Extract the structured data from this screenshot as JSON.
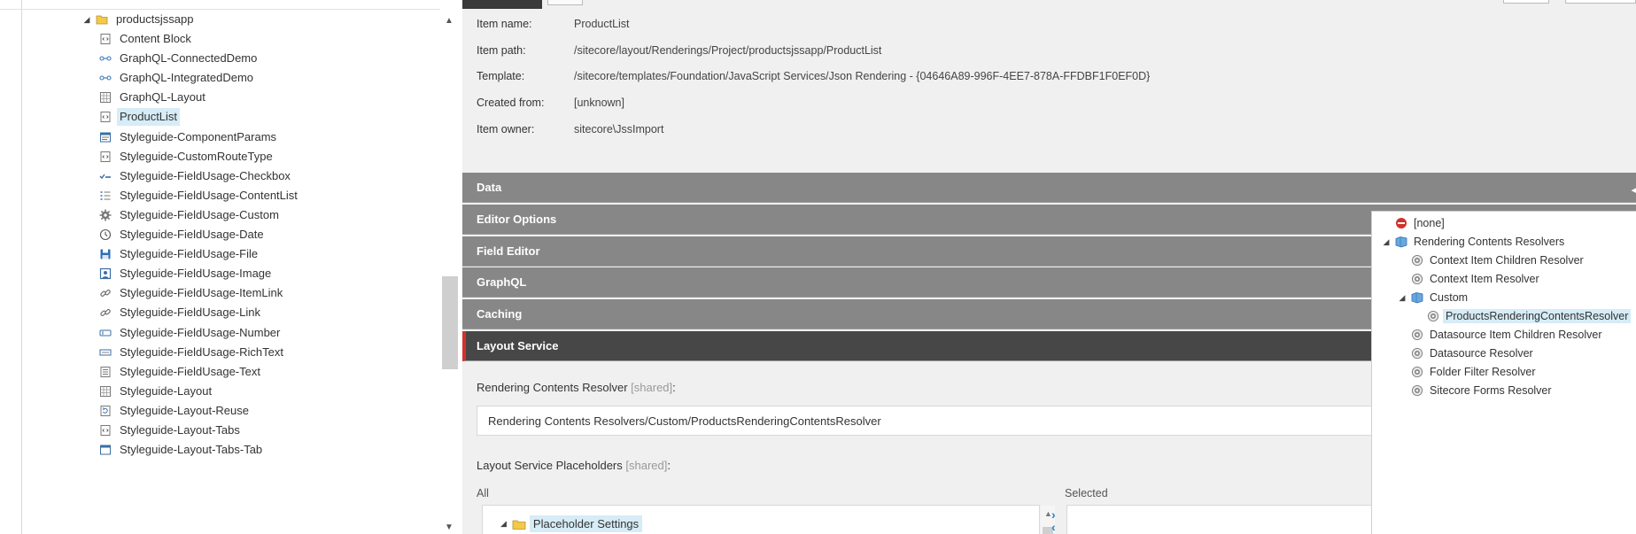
{
  "tree": {
    "parent": {
      "label": "productsjssapp",
      "icon": "folder-icon"
    },
    "items": [
      {
        "label": "Content Block",
        "icon": "json-rendering-icon"
      },
      {
        "label": "GraphQL-ConnectedDemo",
        "icon": "graphql-link-icon"
      },
      {
        "label": "GraphQL-IntegratedDemo",
        "icon": "graphql-link-icon"
      },
      {
        "label": "GraphQL-Layout",
        "icon": "grid-layout-icon"
      },
      {
        "label": "ProductList",
        "icon": "json-rendering-icon",
        "selected": true
      },
      {
        "label": "Styleguide-ComponentParams",
        "icon": "params-form-icon"
      },
      {
        "label": "Styleguide-CustomRouteType",
        "icon": "json-rendering-icon"
      },
      {
        "label": "Styleguide-FieldUsage-Checkbox",
        "icon": "checkbox-field-icon"
      },
      {
        "label": "Styleguide-FieldUsage-ContentList",
        "icon": "content-list-icon"
      },
      {
        "label": "Styleguide-FieldUsage-Custom",
        "icon": "gear-icon"
      },
      {
        "label": "Styleguide-FieldUsage-Date",
        "icon": "clock-icon"
      },
      {
        "label": "Styleguide-FieldUsage-File",
        "icon": "floppy-disk-icon"
      },
      {
        "label": "Styleguide-FieldUsage-Image",
        "icon": "image-frame-icon"
      },
      {
        "label": "Styleguide-FieldUsage-ItemLink",
        "icon": "chain-link-icon"
      },
      {
        "label": "Styleguide-FieldUsage-Link",
        "icon": "chain-link-icon"
      },
      {
        "label": "Styleguide-FieldUsage-Number",
        "icon": "number-field-icon"
      },
      {
        "label": "Styleguide-FieldUsage-RichText",
        "icon": "richtext-field-icon"
      },
      {
        "label": "Styleguide-FieldUsage-Text",
        "icon": "text-field-icon"
      },
      {
        "label": "Styleguide-Layout",
        "icon": "grid-layout-icon"
      },
      {
        "label": "Styleguide-Layout-Reuse",
        "icon": "reuse-layout-icon"
      },
      {
        "label": "Styleguide-Layout-Tabs",
        "icon": "json-rendering-icon"
      },
      {
        "label": "Styleguide-Layout-Tabs-Tab",
        "icon": "window-tab-icon"
      }
    ]
  },
  "quick_info": [
    {
      "key": "Item name:",
      "value": "ProductList"
    },
    {
      "key": "Item path:",
      "value": "/sitecore/layout/Renderings/Project/productsjssapp/ProductList"
    },
    {
      "key": "Template:",
      "value": "/sitecore/templates/Foundation/JavaScript Services/Json Rendering - {04646A89-996F-4EE7-878A-FFDBF1F0EF0D}"
    },
    {
      "key": "Created from:",
      "value": "[unknown]"
    },
    {
      "key": "Item owner:",
      "value": "sitecore\\JssImport"
    }
  ],
  "sections": [
    {
      "label": "Data",
      "active": false
    },
    {
      "label": "Editor Options",
      "active": false
    },
    {
      "label": "Field Editor",
      "active": false
    },
    {
      "label": "GraphQL",
      "active": false
    },
    {
      "label": "Caching",
      "active": false
    },
    {
      "label": "Layout Service",
      "active": true
    }
  ],
  "fields": {
    "resolver_label": "Rendering Contents Resolver",
    "resolver_shared": "[shared]",
    "resolver_colon": ":",
    "resolver_value": "Rendering Contents Resolvers/Custom/ProductsRenderingContentsResolver",
    "placeholders_label": "Layout Service Placeholders",
    "placeholders_shared": "[shared]",
    "placeholders_colon": ":",
    "all_heading": "All",
    "selected_heading": "Selected",
    "placeholder_node": "Placeholder Settings"
  },
  "popup": {
    "items": [
      {
        "label": "[none]",
        "icon": "none-stop-icon",
        "level": 0
      },
      {
        "label": "Rendering Contents Resolvers",
        "icon": "resolver-folder-icon",
        "level": 0,
        "expanded": true
      },
      {
        "label": "Context Item Children Resolver",
        "icon": "resolver-gear-icon",
        "level": 1
      },
      {
        "label": "Context Item Resolver",
        "icon": "resolver-gear-icon",
        "level": 1
      },
      {
        "label": "Custom",
        "icon": "resolver-folder-icon",
        "level": 1,
        "expanded": true
      },
      {
        "label": "ProductsRenderingContentsResolver",
        "icon": "resolver-gear-icon",
        "level": 2,
        "selected": true
      },
      {
        "label": "Datasource Item Children Resolver",
        "icon": "resolver-gear-icon",
        "level": 1
      },
      {
        "label": "Datasource Resolver",
        "icon": "resolver-gear-icon",
        "level": 1
      },
      {
        "label": "Folder Filter Resolver",
        "icon": "resolver-gear-icon",
        "level": 1
      },
      {
        "label": "Sitecore Forms Resolver",
        "icon": "resolver-gear-icon",
        "level": 1
      }
    ]
  },
  "colors": {
    "section_bg": "#878787",
    "section_active_bg": "#474747",
    "accent_red": "#d4312a",
    "selection_bg": "#d6ecf6",
    "link_blue": "#2a7fc0"
  }
}
